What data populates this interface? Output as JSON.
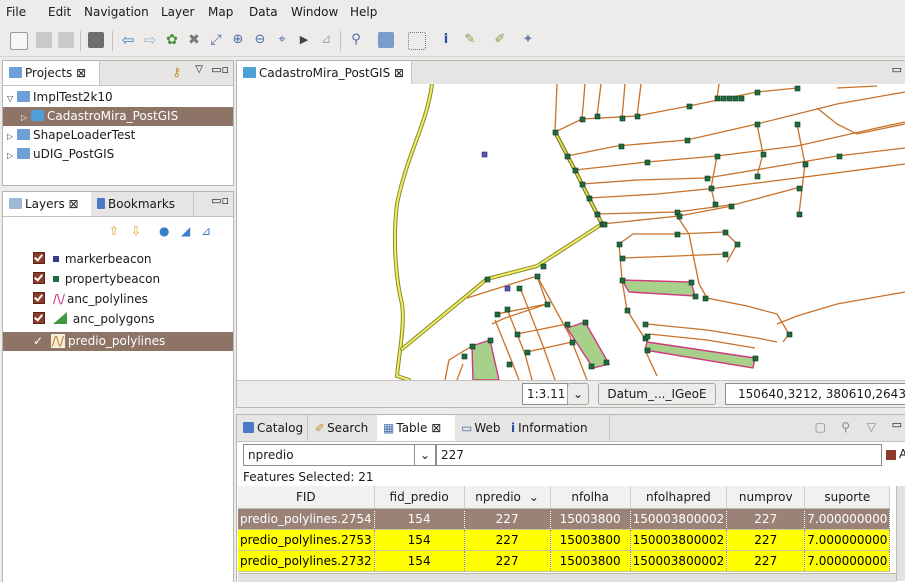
{
  "menu": [
    "File",
    "Edit",
    "Navigation",
    "Layer",
    "Map",
    "Data",
    "Window",
    "Help"
  ],
  "projects": {
    "tab_label": "Projects ⊠",
    "tree": [
      {
        "label": "ImplTest2k10",
        "indent": 0,
        "expanded": true
      },
      {
        "label": "CadastroMira_PostGIS",
        "indent": 1,
        "selected": true
      },
      {
        "label": "ShapeLoaderTest",
        "indent": 0
      },
      {
        "label": "uDIG_PostGIS",
        "indent": 0
      }
    ]
  },
  "layers_panel": {
    "tab_label": "Layers ⊠",
    "bookmarks_label": "Bookmarks",
    "layers": [
      {
        "name": "markerbeacon",
        "color": "#3a3a8c"
      },
      {
        "name": "propertybeacon",
        "color": "#1f6b3f"
      },
      {
        "name": "anc_polylines",
        "color": "#d02080"
      },
      {
        "name": "anc_polygons",
        "color": "#3f9a3f"
      },
      {
        "name": "predio_polylines",
        "color": "#c07020",
        "selected": true
      }
    ]
  },
  "map_editor": {
    "tab_label": "CadastroMira_PostGIS ⊠",
    "scale": "1:3.11",
    "crs_button": "Datum_..._IGeoE",
    "coords": "150640,3212, 380610,2643"
  },
  "bottom_tabs": [
    "Catalog",
    "Search",
    "Table ⊠",
    "Web",
    "Information"
  ],
  "filter": {
    "attribute": "npredio",
    "value": "227"
  },
  "features_selected": "Features Selected: 21",
  "table": {
    "columns": [
      "FID",
      "fid_predio",
      "npredio",
      "nfolha",
      "nfolhapred",
      "numprov",
      "suporte"
    ],
    "rows": [
      {
        "state": "selected",
        "cells": [
          "predio_polylines.2754",
          "154",
          "227",
          "15003800",
          "150003800002",
          "227",
          "7.000000000"
        ]
      },
      {
        "state": "highlight",
        "cells": [
          "predio_polylines.2753",
          "154",
          "227",
          "15003800",
          "150003800002",
          "227",
          "7.000000000"
        ]
      },
      {
        "state": "highlight",
        "cells": [
          "predio_polylines.2732",
          "154",
          "227",
          "15003800",
          "150003800002",
          "227",
          "7.000000000"
        ]
      }
    ]
  },
  "colors": {
    "selection": "#8d7466",
    "highlight": "#ffff00",
    "road": "#c8722a",
    "beacon": "#1f6b3f",
    "parcel": "#a7d08b"
  }
}
